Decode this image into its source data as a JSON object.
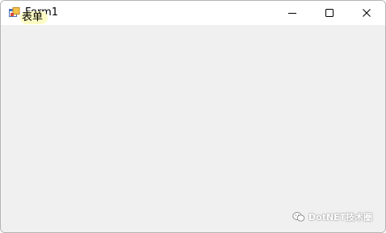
{
  "window": {
    "title": "Form1",
    "overlay_label": "表单"
  },
  "controls": {
    "minimize_icon": "minimize-icon",
    "maximize_icon": "maximize-icon",
    "close_icon": "close-icon"
  },
  "watermark": {
    "text": "DotNET技术圈",
    "icon": "wechat-icon"
  },
  "colors": {
    "client_background": "#f0f0f0",
    "titlebar": "#ffffff",
    "highlight": "#fdfbc4"
  }
}
